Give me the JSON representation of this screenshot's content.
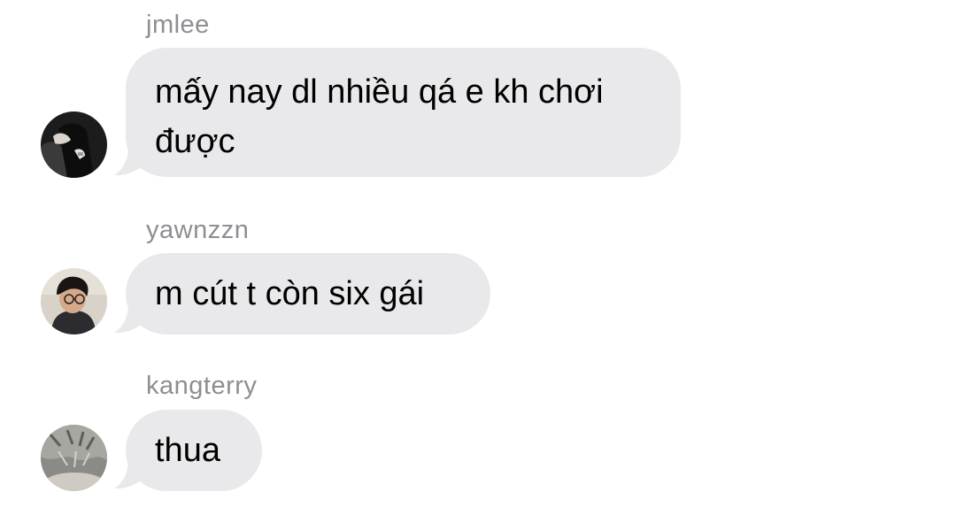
{
  "messages": [
    {
      "sender": "jmlee",
      "text": "mấy nay dl nhiều qá e kh chơi được",
      "avatar_icon": "person-dark-avatar"
    },
    {
      "sender": "yawnzzn",
      "text": "m cút t còn six gái",
      "avatar_icon": "person-glasses-avatar"
    },
    {
      "sender": "kangterry",
      "text": "thua",
      "avatar_icon": "gray-pattern-avatar"
    }
  ],
  "colors": {
    "bubble": "#e9e9eb",
    "sender_label": "#8e8e93",
    "background": "#ffffff"
  }
}
